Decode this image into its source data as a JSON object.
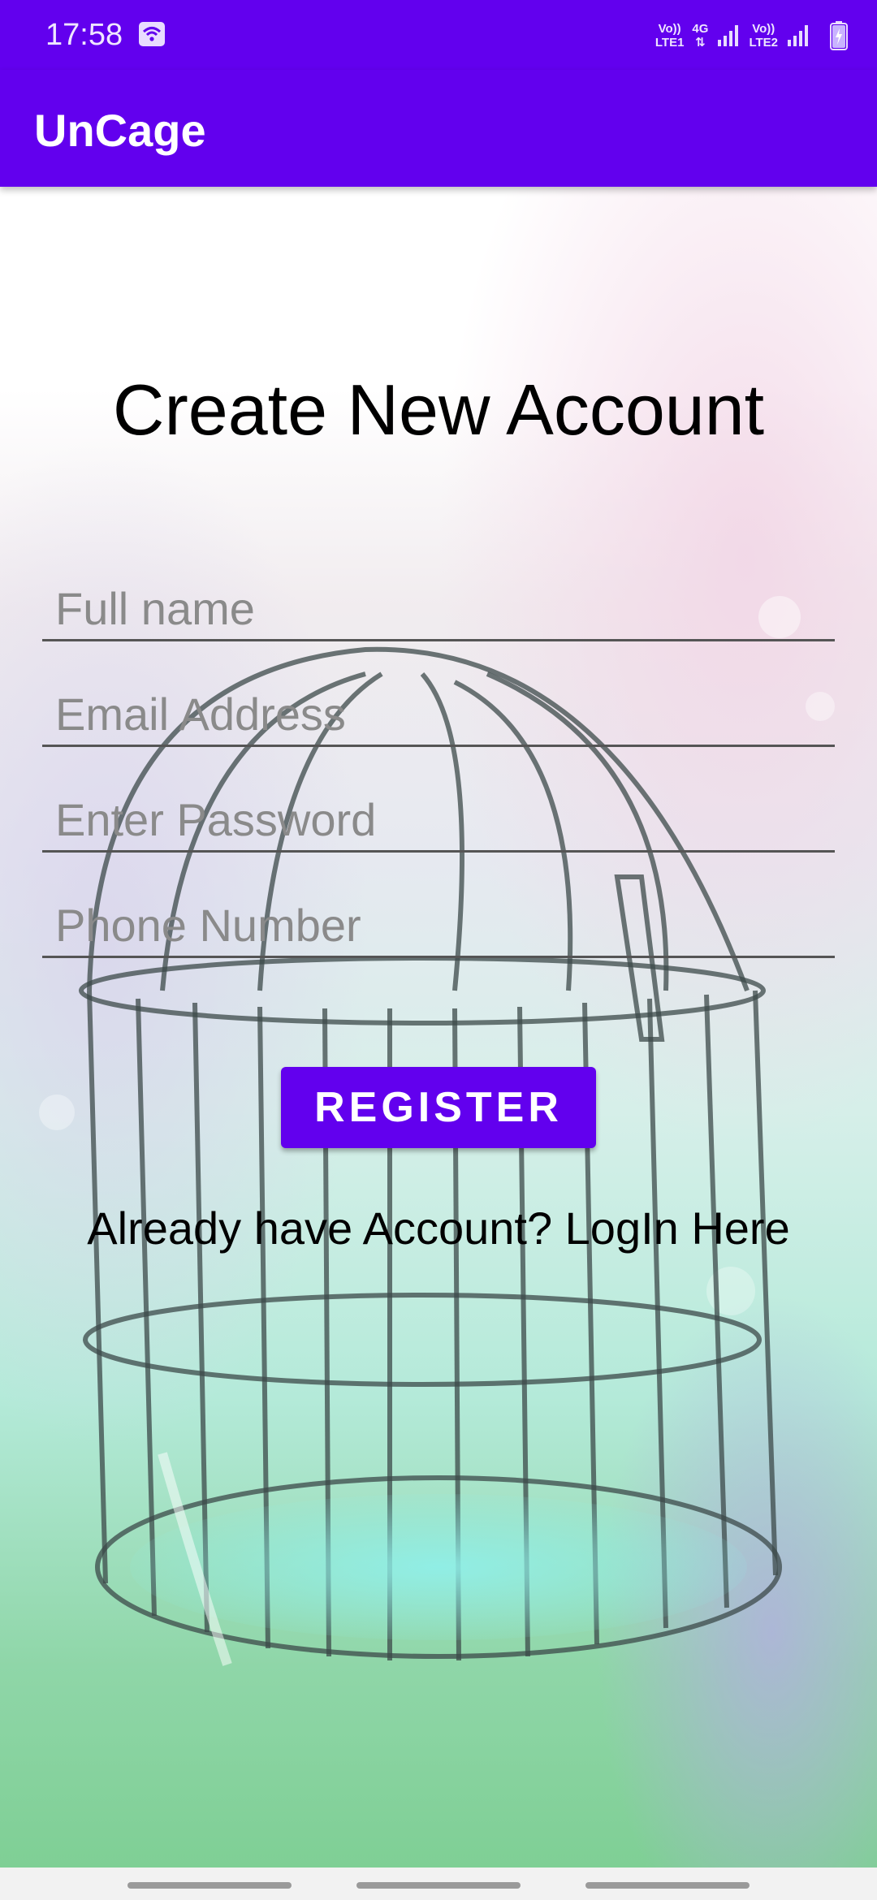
{
  "status_bar": {
    "time": "17:58",
    "sim1": {
      "top": "Vo))",
      "bottom": "LTE1"
    },
    "net": {
      "top": "4G",
      "bottom": "⇅"
    },
    "sim2": {
      "top": "Vo))",
      "bottom": "LTE2"
    }
  },
  "app_bar": {
    "title": "UnCage"
  },
  "form": {
    "title": "Create New Account",
    "fields": [
      {
        "placeholder": "Full name",
        "value": ""
      },
      {
        "placeholder": "Email Address",
        "value": ""
      },
      {
        "placeholder": "Enter Password",
        "value": ""
      },
      {
        "placeholder": "Phone Number",
        "value": ""
      }
    ],
    "register_label": "REGISTER",
    "login_link": "Already have Account? LogIn Here"
  },
  "colors": {
    "primary": "#6200ee",
    "background_tint": "#bfe8d8"
  },
  "icons": [
    "wifi-icon",
    "signal-icon",
    "battery-icon",
    "birdcage-illustration"
  ]
}
